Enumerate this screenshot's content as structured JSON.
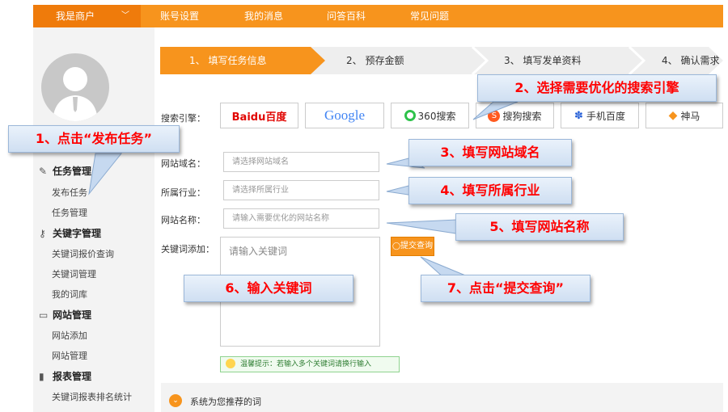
{
  "topnav": {
    "merchant": "我是商户",
    "items": [
      "账号设置",
      "我的消息",
      "问答百科",
      "常见问题"
    ]
  },
  "sidebar": {
    "sections": [
      {
        "title": "任务管理",
        "icon": "edit-icon",
        "items": [
          "发布任务",
          "任务管理"
        ]
      },
      {
        "title": "关键字管理",
        "icon": "key-icon",
        "items": [
          "关键词报价查询",
          "关键词管理",
          "我的词库"
        ]
      },
      {
        "title": "网站管理",
        "icon": "monitor-icon",
        "items": [
          "网站添加",
          "网站管理"
        ]
      },
      {
        "title": "报表管理",
        "icon": "bar-chart-icon",
        "items": [
          "关键词报表排名统计"
        ]
      }
    ]
  },
  "steps": [
    "1、 填写任务信息",
    "2、 预存金额",
    "3、 填写发单资料",
    "4、 确认需求"
  ],
  "form": {
    "engine_label": "搜索引擎：",
    "engines": [
      "Baidu百度",
      "Google",
      "360搜索",
      "搜狗搜索",
      "手机百度",
      "神马"
    ],
    "domain_label": "网站域名：",
    "domain_placeholder": "请选择网站域名",
    "industry_label": "所属行业：",
    "industry_placeholder": "请选择所属行业",
    "site_name_label": "网站名称：",
    "site_name_placeholder": "请输入需要优化的网站名称",
    "keyword_label": "关键词添加：",
    "keyword_placeholder": "请输入关键词",
    "submit_label": "提交查询",
    "tip": "温馨提示：若输入多个关键词请换行输入"
  },
  "recommend": "系统为您推荐的词",
  "callouts": {
    "c1": "1、点击“发布任务”",
    "c2": "2、选择需要优化的搜索引擎",
    "c3": "3、填写网站域名",
    "c4": "4、填写所属行业",
    "c5": "5、填写网站名称",
    "c6": "6、输入关键词",
    "c7": "7、点击“提交查询”"
  },
  "colors": {
    "accent": "#f7941d",
    "callout_text": "#ff0000"
  }
}
